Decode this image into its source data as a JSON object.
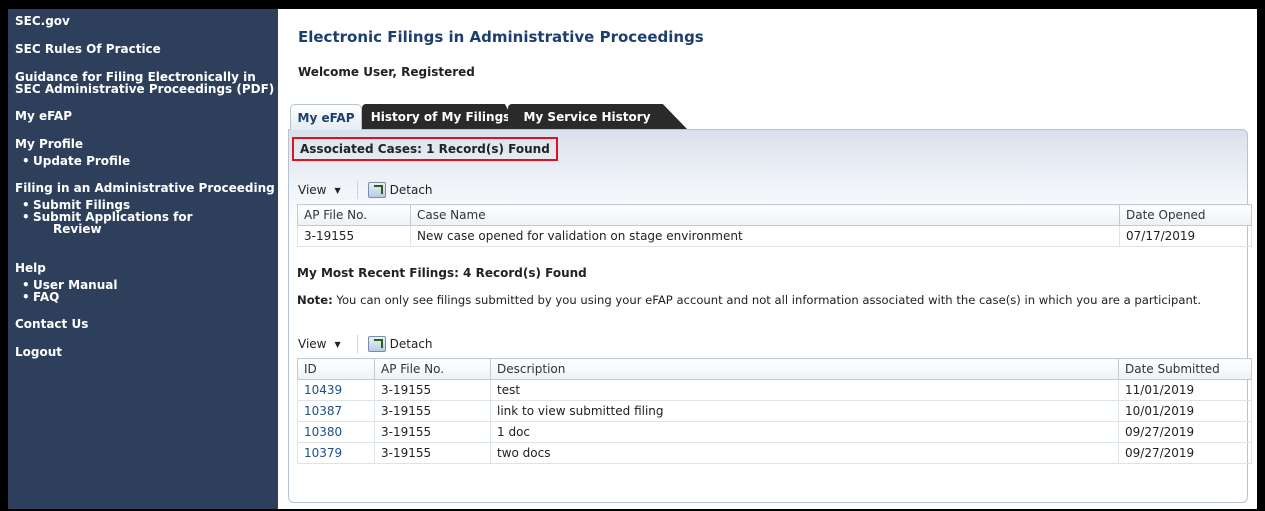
{
  "sidebar": {
    "items": [
      {
        "label": "SEC.gov"
      },
      {
        "label": "SEC Rules Of Practice"
      },
      {
        "label_line1": "Guidance for Filing Electronically in",
        "label_line2": "SEC Administrative Proceedings (PDF)"
      },
      {
        "label": "My eFAP"
      },
      {
        "label": "My Profile",
        "children": [
          "Update Profile"
        ]
      },
      {
        "label": "Filing in an Administrative Proceeding",
        "children": [
          "Submit Filings",
          "Submit Applications for",
          "Review"
        ]
      },
      {
        "label": "Help",
        "children": [
          "User Manual",
          "FAQ"
        ]
      },
      {
        "label": "Contact Us"
      },
      {
        "label": "Logout"
      }
    ]
  },
  "header": {
    "title": "Electronic Filings in Administrative Proceedings",
    "welcome": "Welcome User, Registered"
  },
  "tabs": [
    {
      "label": "My eFAP",
      "active": true
    },
    {
      "label": "History of My Filings",
      "active": false
    },
    {
      "label": "My Service History",
      "active": false
    }
  ],
  "associated_cases": {
    "heading": "Associated Cases: 1 Record(s) Found",
    "toolbar": {
      "view_label": "View",
      "detach_label": "Detach"
    },
    "columns": [
      "AP File No.",
      "Case Name",
      "Date Opened"
    ],
    "rows": [
      [
        "3-19155",
        "New case opened for validation on stage environment",
        "07/17/2019"
      ]
    ]
  },
  "recent_filings": {
    "heading": "My Most Recent Filings: 4 Record(s) Found",
    "note_label": "Note:",
    "note_text": " You can only see filings submitted by you using your eFAP account and not all information associated with the case(s) in which you are a participant.",
    "toolbar": {
      "view_label": "View",
      "detach_label": "Detach"
    },
    "columns": [
      "ID",
      "AP File No.",
      "Description",
      "Date Submitted"
    ],
    "rows": [
      [
        "10439",
        "3-19155",
        "test",
        "11/01/2019"
      ],
      [
        "10387",
        "3-19155",
        "link to view submitted filing",
        "10/01/2019"
      ],
      [
        "10380",
        "3-19155",
        "1 doc",
        "09/27/2019"
      ],
      [
        "10379",
        "3-19155",
        "two docs",
        "09/27/2019"
      ]
    ]
  },
  "colors": {
    "sidebar_bg": "#2d3f5b",
    "title": "#1c3f6e",
    "highlight_border": "#e01020",
    "link": "#1c4f8a"
  }
}
